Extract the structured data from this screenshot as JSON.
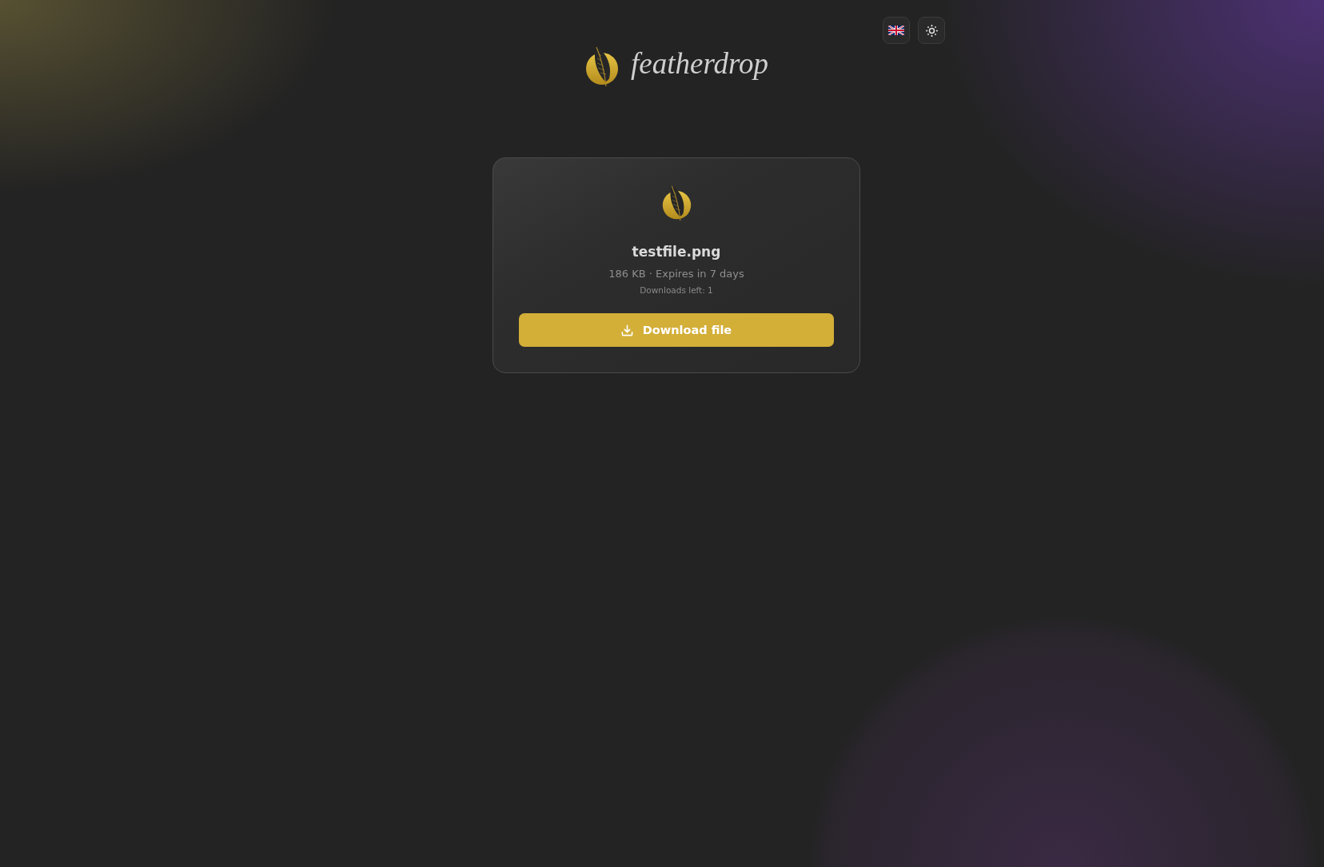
{
  "header": {
    "buttons": [
      {
        "kind": "language"
      },
      {
        "kind": "theme"
      }
    ],
    "logo": {
      "text": "featherdrop"
    }
  },
  "file_card": {
    "file_name": "testfile.png",
    "details": "186 KB · Expires in 7 days",
    "downloads_left": "Downloads left: 1",
    "download_button": {
      "label": "Download file"
    }
  }
}
